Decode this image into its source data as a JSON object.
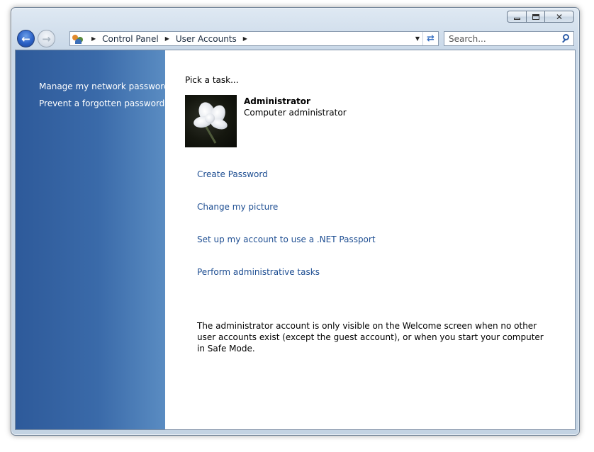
{
  "window": {
    "caption": {
      "minimize_icon": "minimize-icon",
      "maximize_icon": "maximize-icon",
      "close_icon": "close-icon"
    }
  },
  "navigation": {
    "back_icon": "back-arrow-icon",
    "forward_icon": "forward-arrow-icon"
  },
  "address_bar": {
    "icon": "user-accounts-icon",
    "breadcrumbs": [
      "Control Panel",
      "User Accounts"
    ],
    "refresh_icon": "refresh-icon"
  },
  "search": {
    "placeholder": "Search...",
    "icon": "search-icon"
  },
  "sidebar": {
    "links": [
      {
        "label": "Manage my network passwords"
      },
      {
        "label": "Prevent a forgotten password"
      }
    ]
  },
  "main": {
    "heading": "Pick a task...",
    "account": {
      "name": "Administrator",
      "role": "Computer administrator",
      "picture": "flower-avatar"
    },
    "tasks": [
      {
        "label": "Create Password"
      },
      {
        "label": "Change my picture"
      },
      {
        "label": "Set up my account to use a .NET Passport"
      },
      {
        "label": "Perform administrative tasks"
      }
    ],
    "info": "The administrator account is only visible on the Welcome screen when no other user accounts exist (except the guest account), or when you start your computer in Safe Mode."
  },
  "colors": {
    "sidebar_dark": "#2e5a9a",
    "sidebar_light": "#5a8cc2",
    "link": "#1e4e92",
    "window_frame": "#c9d8e8"
  }
}
